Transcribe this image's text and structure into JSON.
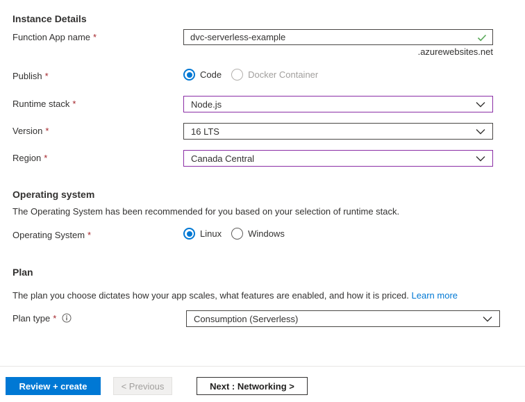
{
  "required_marker": "*",
  "colors": {
    "primary": "#0078d4",
    "changed_field_border": "#8a2da5",
    "required_red": "#a4262c",
    "valid_green": "#59a859",
    "link_blue": "#0078d4"
  },
  "instance_details": {
    "heading": "Instance Details",
    "function_app_name": {
      "label": "Function App name",
      "value": "dvc-serverless-example",
      "suffix": ".azurewebsites.net",
      "valid": true
    },
    "publish": {
      "label": "Publish",
      "options": [
        {
          "label": "Code",
          "selected": true
        },
        {
          "label": "Docker Container",
          "selected": false
        }
      ]
    },
    "runtime_stack": {
      "label": "Runtime stack",
      "value": "Node.js"
    },
    "version": {
      "label": "Version",
      "value": "16 LTS"
    },
    "region": {
      "label": "Region",
      "value": "Canada Central"
    }
  },
  "operating_system": {
    "heading": "Operating system",
    "description": "The Operating System has been recommended for you based on your selection of runtime stack.",
    "field": {
      "label": "Operating System",
      "options": [
        {
          "label": "Linux",
          "selected": true
        },
        {
          "label": "Windows",
          "selected": false
        }
      ]
    }
  },
  "plan": {
    "heading": "Plan",
    "description": "The plan you choose dictates how your app scales, what features are enabled, and how it is priced.",
    "learn_more": "Learn more",
    "plan_type": {
      "label": "Plan type",
      "value": "Consumption (Serverless)"
    }
  },
  "footer": {
    "review_create": "Review + create",
    "previous": "< Previous",
    "next": "Next : Networking >"
  }
}
